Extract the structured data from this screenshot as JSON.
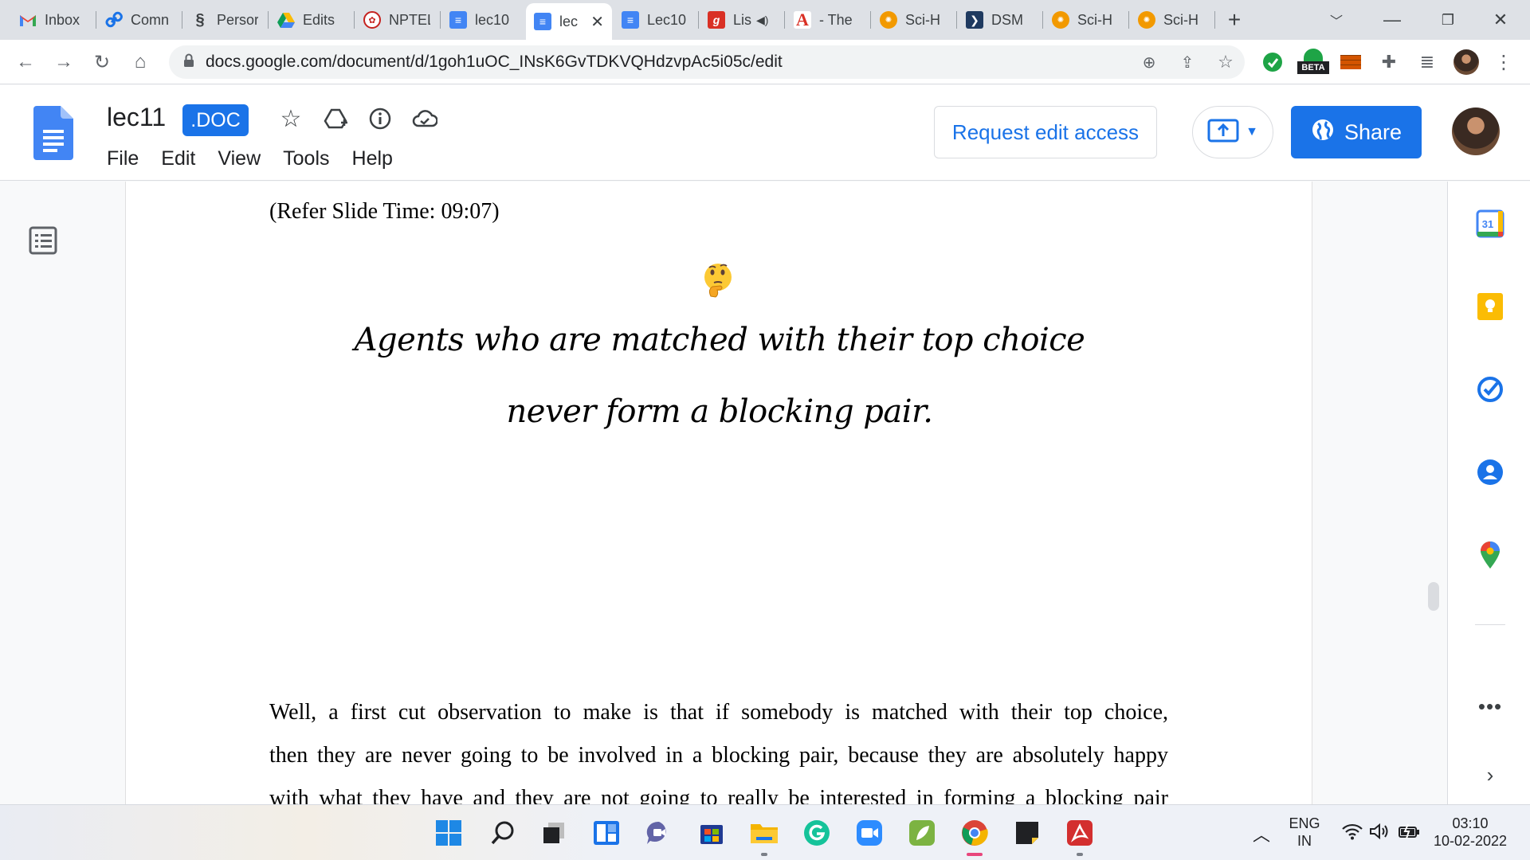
{
  "browser": {
    "tabs": [
      {
        "label": "Inbox",
        "icon": "gmail-icon"
      },
      {
        "label": "Comn",
        "icon": "link-icon"
      },
      {
        "label": "Persor",
        "icon": "dna-icon"
      },
      {
        "label": "Edits",
        "icon": "drive-icon"
      },
      {
        "label": "NPTEL",
        "icon": "nptel-icon"
      },
      {
        "label": "lec10",
        "icon": "docs-icon"
      },
      {
        "label": "lec",
        "icon": "docs-icon",
        "active": true
      },
      {
        "label": "Lec10",
        "icon": "docs-icon"
      },
      {
        "label": "Lis",
        "icon": "g-icon"
      },
      {
        "label": "- The",
        "icon": "acrobat-a-icon"
      },
      {
        "label": "Sci-H",
        "icon": "scihub-icon"
      },
      {
        "label": "DSM",
        "icon": "arrow-icon"
      },
      {
        "label": "Sci-H",
        "icon": "scihub-icon"
      },
      {
        "label": "Sci-H",
        "icon": "scihub-icon"
      }
    ],
    "url": "docs.google.com/document/d/1goh1uOC_INsK6GvTDKVQHdzvpAc5i05c/edit",
    "beta_badge": "BETA"
  },
  "docs": {
    "title": "lec11",
    "badge": ".DOC",
    "menu": [
      "File",
      "Edit",
      "View",
      "Tools",
      "Help"
    ],
    "request_edit": "Request edit access",
    "share": "Share"
  },
  "document": {
    "refer": "(Refer Slide Time: 09:07)",
    "handwritten": [
      "Agents who are matched with their top choice",
      "never form a blocking pair."
    ],
    "paragraph_lines": [
      "Well, a first cut observation to make is that if somebody is matched with their top choice,",
      "then they are never going to be involved in a blocking pair, because they are absolutely happy",
      "with what they have and they are not going to really be interested in forming a blocking pair"
    ]
  },
  "sidepanel": {
    "calendar_day": "31"
  },
  "taskbar": {
    "lang": "ENG",
    "region": "IN",
    "time": "03:10",
    "date": "10-02-2022"
  },
  "colors": {
    "accent": "#1a73e8",
    "tabstrip": "#dee1e6"
  }
}
